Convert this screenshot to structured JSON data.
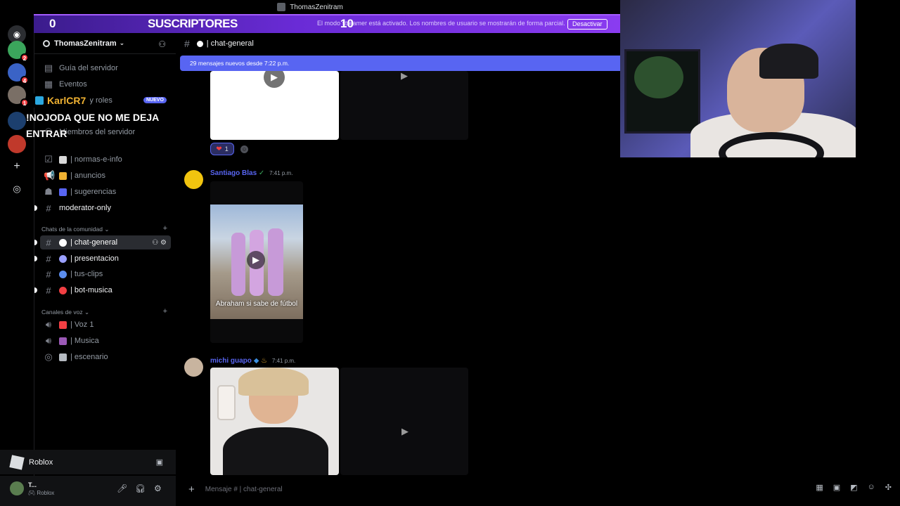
{
  "titlebar": {
    "title": "ThomasZenitram"
  },
  "banner": {
    "left_count": "0",
    "label": "SUSCRIPTORES",
    "right_count": "10",
    "streamer_notice": "El modo streamer está activado. Los nombres de usuario se mostrarán de forma parcial.",
    "deactivate_label": "Desactivar"
  },
  "rail": {
    "servers": [
      {
        "name": "discord-home",
        "color": "#2b2d31",
        "badge": ""
      },
      {
        "name": "server-1",
        "color": "#3ba55c",
        "badge": "2"
      },
      {
        "name": "server-2",
        "color": "#3a63c6",
        "badge": "4"
      },
      {
        "name": "server-3",
        "color": "#7a6f66",
        "badge": "1"
      },
      {
        "name": "server-4",
        "color": "#1c3f6e",
        "badge": ""
      },
      {
        "name": "server-5",
        "color": "#c0392b",
        "badge": ""
      }
    ]
  },
  "server": {
    "name": "ThomasZenitram"
  },
  "sidebar": {
    "top_items": [
      {
        "label": "Guía del servidor"
      },
      {
        "label": "Eventos"
      },
      {
        "label": "Canales y roles"
      },
      {
        "label": "Miembros del servidor"
      }
    ],
    "new_badge": "NUEVO",
    "channels_top": [
      {
        "label": "| normas-e-info",
        "emoji_color": "#d9d9d9"
      },
      {
        "label": "| anuncios",
        "emoji_color": "#f0b232"
      },
      {
        "label": "| sugerencias",
        "emoji_color": "#5865f2"
      },
      {
        "label": "moderator-only",
        "emoji_color": ""
      }
    ],
    "category_community": "Chats de la comunidad",
    "channels_community": [
      {
        "label": "| chat-general",
        "emoji_color": "#ffffff"
      },
      {
        "label": "| presentacion",
        "emoji_color": "#9aa0ff"
      },
      {
        "label": "| tus-clips",
        "emoji_color": "#5b8def"
      },
      {
        "label": "| bot-musica",
        "emoji_color": "#f23f43"
      }
    ],
    "category_voice": "Canales de voz",
    "voice_channels": [
      {
        "label": "| Voz 1",
        "emoji_color": "#f23f43"
      },
      {
        "label": "| Musica",
        "emoji_color": "#9b59b6"
      },
      {
        "label": "| escenario",
        "emoji_color": "#b5bac1"
      }
    ]
  },
  "overlay": {
    "alert_user": "KarlCR7",
    "alert_message": "!NOJODA QUE NO ME DEJA ENTRAR"
  },
  "activity": {
    "game": "Roblox"
  },
  "user": {
    "name": "T...",
    "status": "Roblox"
  },
  "chat": {
    "channel": "| chat-general",
    "new_messages": "29 mensajes nuevos desde 7:22 p.m.",
    "reaction_count": "1",
    "messages": [
      {
        "author": "Santiago Blas",
        "author_color": "#5865f2",
        "time": "7:41 p.m.",
        "caption": "Abraham si sabe de fútbol"
      },
      {
        "author": "michi guapo",
        "author_color": "#5865f2",
        "time": "7:41 p.m."
      }
    ]
  },
  "composer": {
    "placeholder": "Mensaje # | chat-general"
  }
}
